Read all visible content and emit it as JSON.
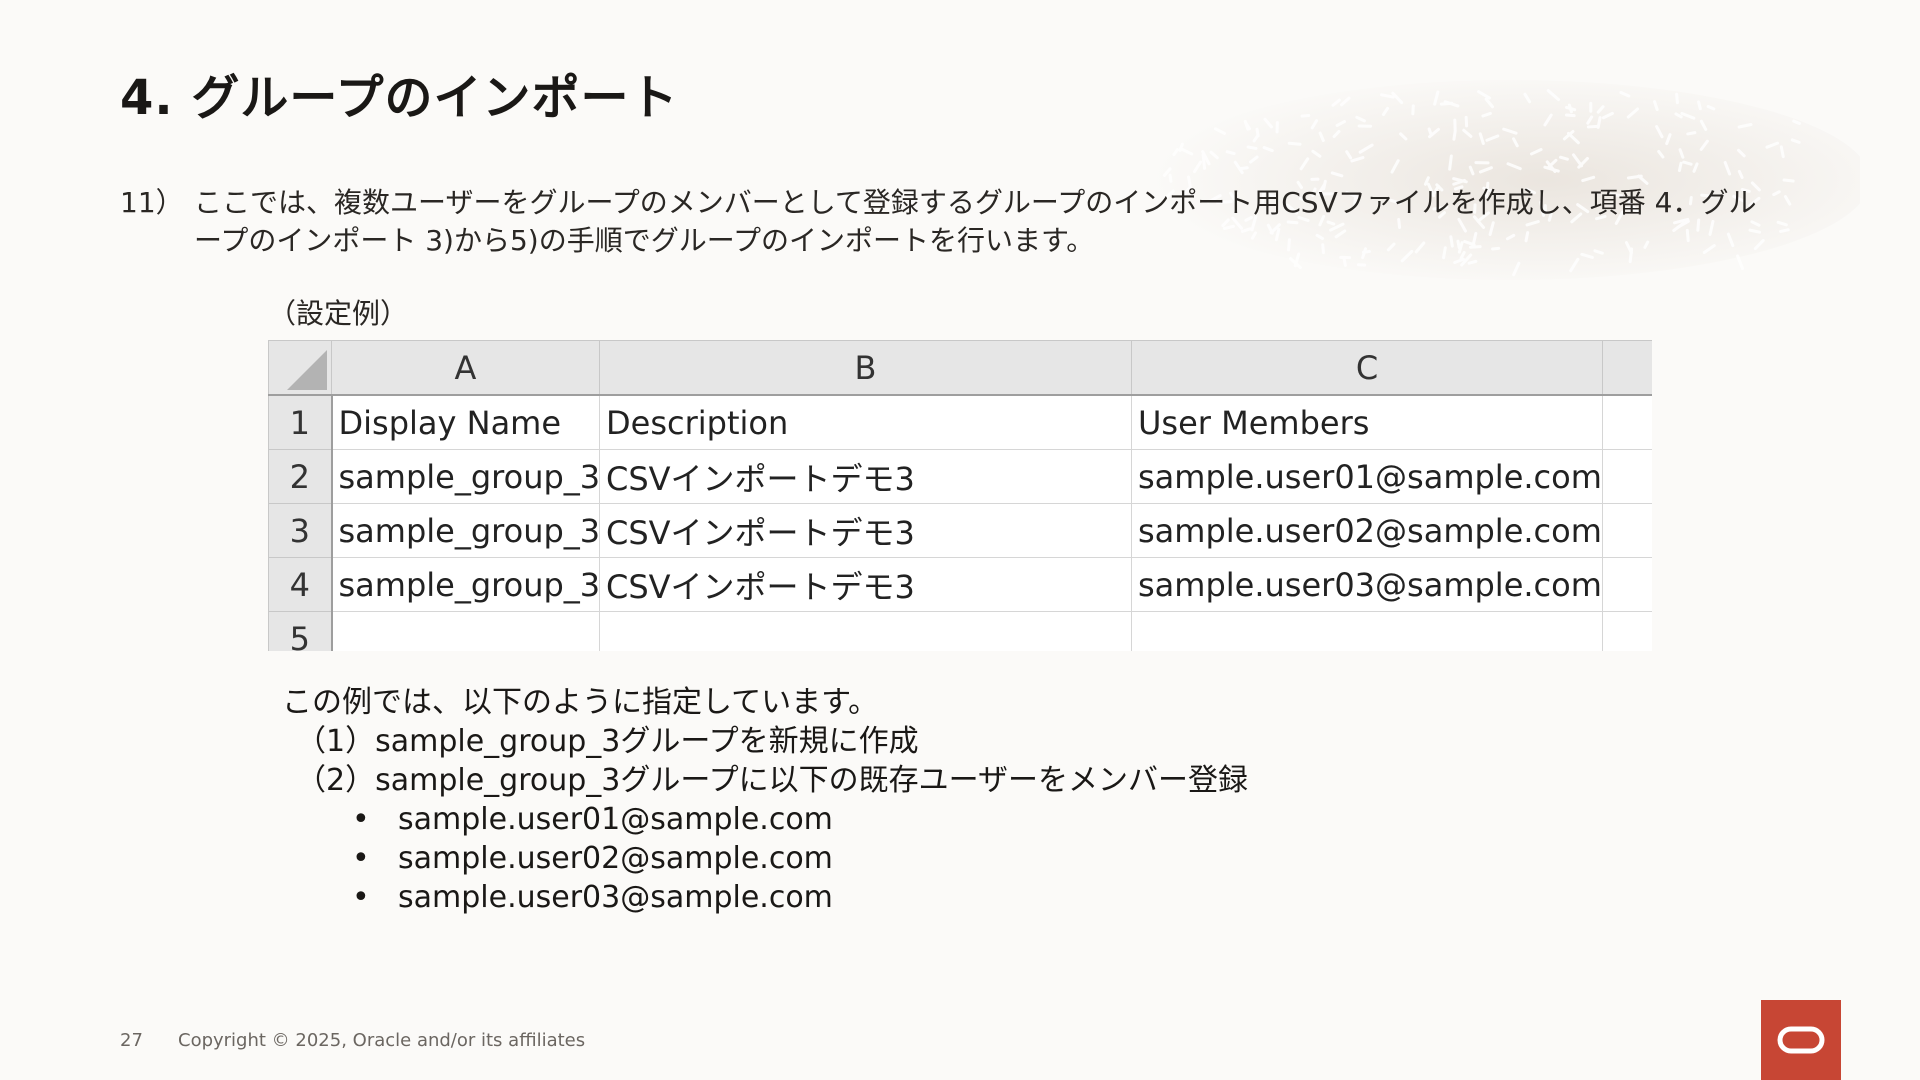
{
  "slide": {
    "title": "4. グループのインポート",
    "step_number": "11）",
    "step_text": "ここでは、複数ユーザーをグループのメンバーとして登録するグループのインポート用CSVファイルを作成し、項番 4．グループのインポート 3)から5)の手順でグループのインポートを行います。",
    "example_label": "（設定例）"
  },
  "sheet": {
    "columns": [
      "A",
      "B",
      "C"
    ],
    "rows": [
      {
        "num": "1",
        "cells": [
          "Display Name",
          "Description",
          "User Members"
        ]
      },
      {
        "num": "2",
        "cells": [
          "sample_group_3",
          "CSVインポートデモ3",
          "sample.user01@sample.com"
        ]
      },
      {
        "num": "3",
        "cells": [
          "sample_group_3",
          "CSVインポートデモ3",
          "sample.user02@sample.com"
        ]
      },
      {
        "num": "4",
        "cells": [
          "sample_group_3",
          "CSVインポートデモ3",
          "sample.user03@sample.com"
        ]
      },
      {
        "num": "5",
        "cells": [
          "",
          "",
          ""
        ]
      }
    ]
  },
  "explanation": {
    "intro": "この例では、以下のように指定しています。",
    "items": [
      "（1）sample_group_3グループを新規に作成",
      "（2）sample_group_3グループに以下の既存ユーザーをメンバー登録"
    ],
    "bullets": [
      "sample.user01@sample.com",
      "sample.user02@sample.com",
      "sample.user03@sample.com"
    ],
    "bullet_glyph": "•"
  },
  "footer": {
    "page_number": "27",
    "copyright": "Copyright © 2025, Oracle and/or its affiliates"
  },
  "colors": {
    "background": "#fbfaf8",
    "brand_red": "#c74634",
    "sheet_header": "#e6e6e6"
  },
  "icons": {
    "logo": "oracle-logo-icon",
    "decoration": "leaf-pattern-decoration-icon"
  }
}
